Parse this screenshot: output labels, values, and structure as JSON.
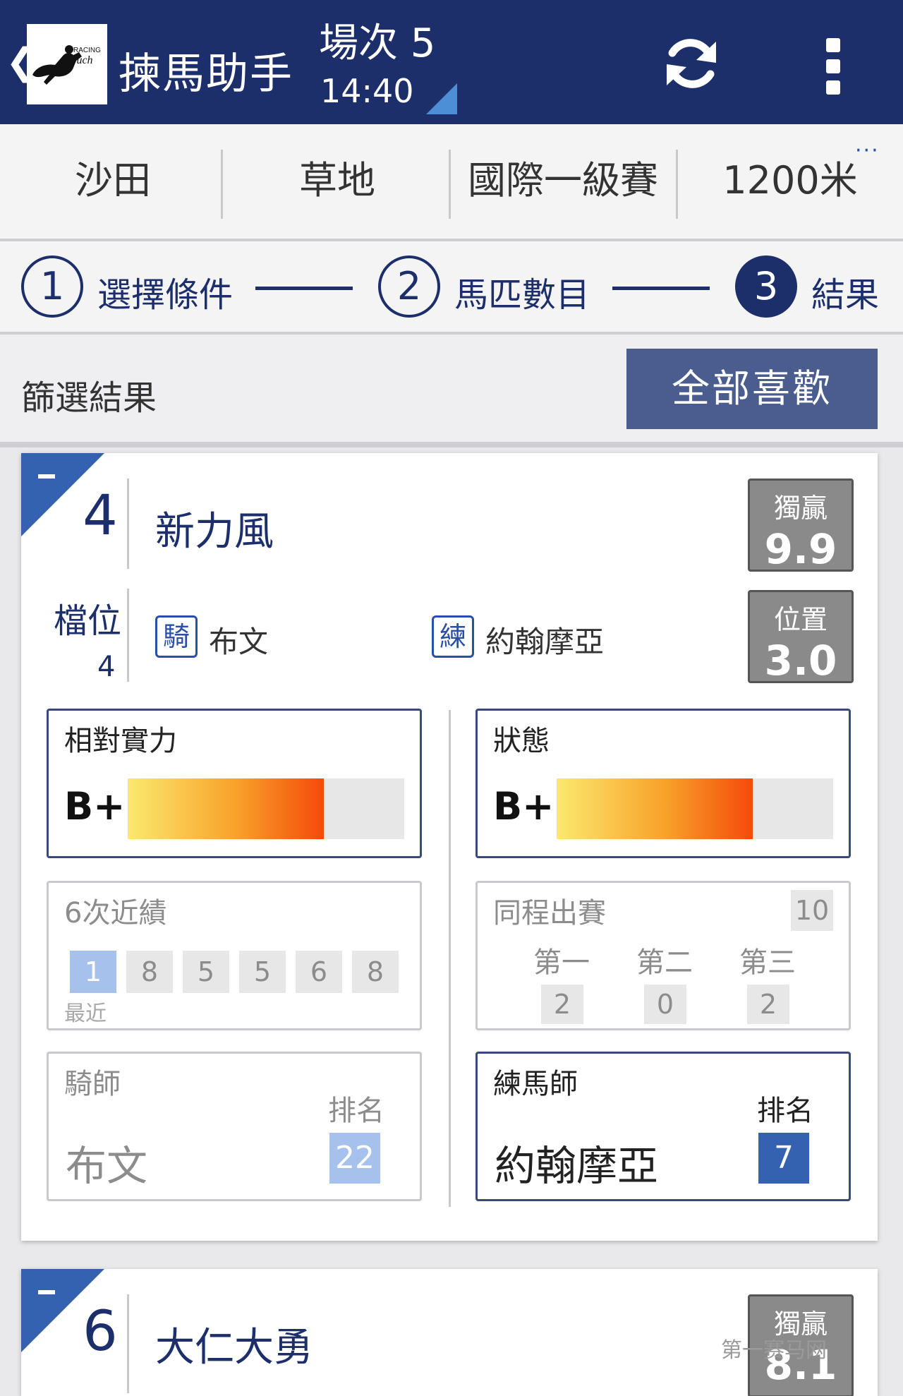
{
  "header": {
    "back_icon": "chevron-left-icon",
    "logo_text": "RACING touch",
    "app_title": "揀馬助手",
    "race_label": "場次 5",
    "race_time": "14:40",
    "refresh_icon": "refresh-icon",
    "menu_icon": "kebab-menu-icon"
  },
  "race_info": [
    "沙田",
    "草地",
    "國際一級賽",
    "1200米"
  ],
  "race_info_more": "···",
  "steps": [
    {
      "num": "1",
      "label": "選擇條件",
      "active": false
    },
    {
      "num": "2",
      "label": "馬匹數目",
      "active": false
    },
    {
      "num": "3",
      "label": "結果",
      "active": true
    }
  ],
  "filter": {
    "title": "篩選結果",
    "fav_button": "全部喜歡"
  },
  "horses": [
    {
      "number": "4",
      "name": "新力風",
      "win_label": "獨贏",
      "win_odds": "9.9",
      "place_label": "位置",
      "place_odds": "3.0",
      "draw_label": "檔位",
      "draw": "4",
      "jockey_tag": "騎",
      "jockey": "布文",
      "trainer_tag": "練",
      "trainer": "約翰摩亞",
      "strength": {
        "title": "相對實力",
        "grade": "B+",
        "level_pct": 71
      },
      "form": {
        "title": "狀態",
        "grade": "B+",
        "level_pct": 71
      },
      "recent": {
        "title": "6次近績",
        "results": [
          "1",
          "8",
          "5",
          "5",
          "6",
          "8"
        ],
        "latest_label": "最近"
      },
      "distance_record": {
        "title": "同程出賽",
        "starts": "10",
        "places": [
          {
            "label": "第一",
            "value": "2"
          },
          {
            "label": "第二",
            "value": "0"
          },
          {
            "label": "第三",
            "value": "2"
          }
        ]
      },
      "jockey_panel": {
        "title": "騎師",
        "name": "布文",
        "rank_label": "排名",
        "rank": "22"
      },
      "trainer_panel": {
        "title": "練馬師",
        "name": "約翰摩亞",
        "rank_label": "排名",
        "rank": "7"
      }
    },
    {
      "number": "6",
      "name": "大仁大勇",
      "win_label": "獨贏",
      "win_odds": "8.1"
    }
  ],
  "watermark": "第一赛马网",
  "colors": {
    "header_bg": "#1c2f6b",
    "accent_blue": "#3562b0",
    "fav_button_bg": "#4a5d8e",
    "rank_highlight": "#3562b0",
    "rank_muted": "#a6c1ec"
  }
}
